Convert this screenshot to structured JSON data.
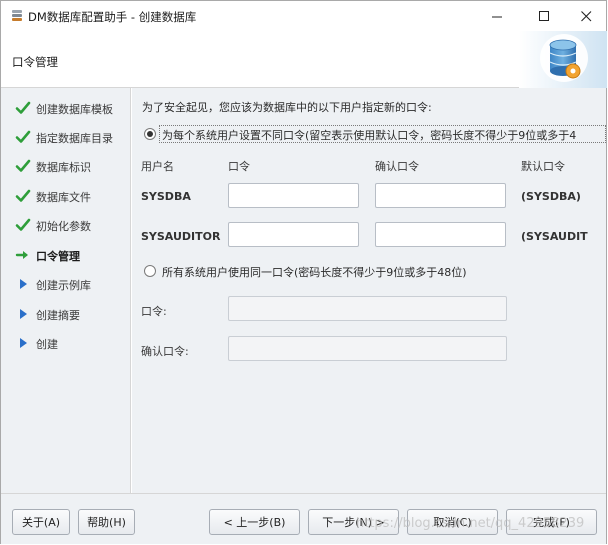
{
  "window": {
    "title": "DM数据库配置助手 - 创建数据库",
    "controls": {
      "minimize": "—",
      "maximize": "☐",
      "close": "✕"
    }
  },
  "header": {
    "title": "口令管理",
    "logo_icon": "database-gear-icon"
  },
  "sidebar": {
    "steps": [
      {
        "label": "创建数据库模板",
        "status": "done"
      },
      {
        "label": "指定数据库目录",
        "status": "done"
      },
      {
        "label": "数据库标识",
        "status": "done"
      },
      {
        "label": "数据库文件",
        "status": "done"
      },
      {
        "label": "初始化参数",
        "status": "done"
      },
      {
        "label": "口令管理",
        "status": "current"
      },
      {
        "label": "创建示例库",
        "status": "pending"
      },
      {
        "label": "创建摘要",
        "status": "pending"
      },
      {
        "label": "创建",
        "status": "pending"
      }
    ]
  },
  "main": {
    "intro": "为了安全起见，您应该为数据库中的以下用户指定新的口令:",
    "option_each": {
      "label": "为每个系统用户设置不同口令(留空表示使用默认口令，密码长度不得少于9位或多于4",
      "selected": true
    },
    "columns": {
      "user": "用户名",
      "password": "口令",
      "confirm": "确认口令",
      "default": "默认口令"
    },
    "users": [
      {
        "name": "SYSDBA",
        "password": "",
        "confirm": "",
        "default": "(SYSDBA)"
      },
      {
        "name": "SYSAUDITOR",
        "password": "",
        "confirm": "",
        "default": "(SYSAUDIT"
      }
    ],
    "option_same": {
      "label": "所有系统用户使用同一口令(密码长度不得少于9位或多于48位)",
      "selected": false
    },
    "same_password_label": "口令:",
    "same_confirm_label": "确认口令:",
    "same_password_value": "",
    "same_confirm_value": ""
  },
  "footer": {
    "about": "关于(A)",
    "help": "帮助(H)",
    "back": "< 上一步(B)",
    "next": "下一步(N) >",
    "cancel": "取消(C)",
    "finish": "完成(F)",
    "watermark": "https://blog.csdn.net/qq_42958239"
  },
  "colors": {
    "check": "#2e9e3a",
    "arrow": "#2e9e3a",
    "pending_arrow": "#2a6fc9",
    "panel_bg": "#eef1f4"
  }
}
